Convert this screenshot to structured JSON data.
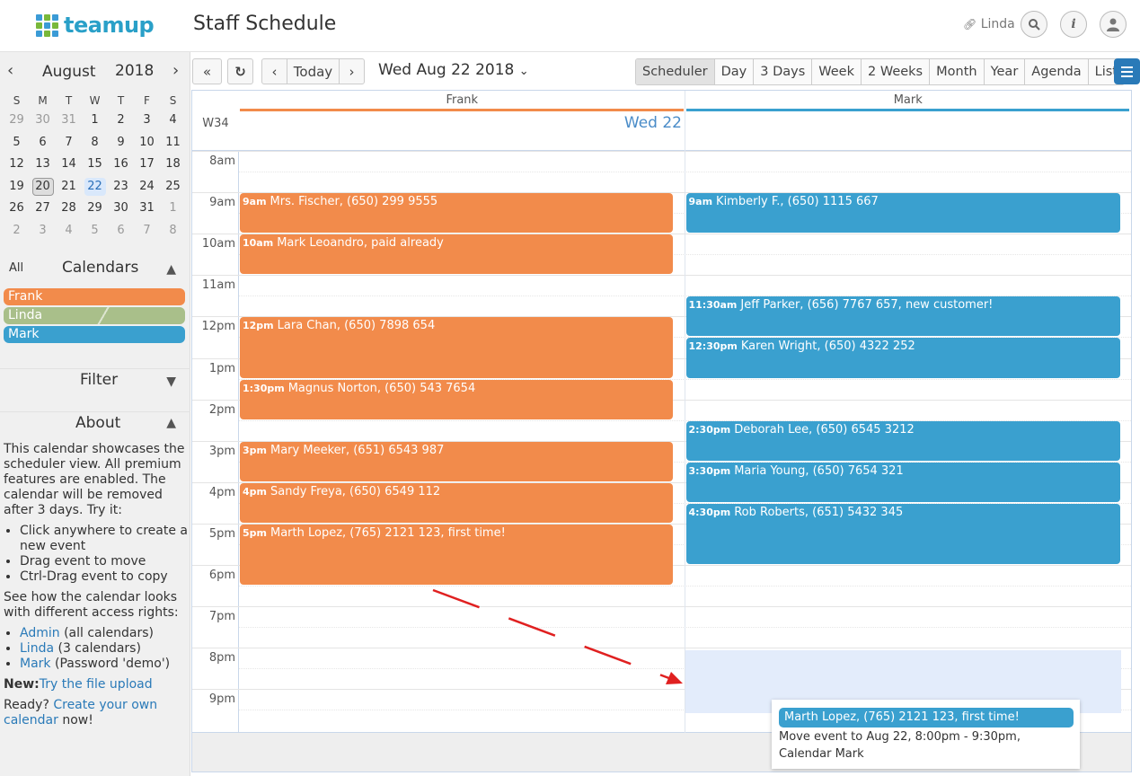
{
  "header": {
    "brand": "teamup",
    "title": "Staff Schedule",
    "user": "Linda",
    "logo_colors": [
      "#3b9bd6",
      "#79b83a",
      "#3b9bd6",
      "#79b83a",
      "#3b9bd6",
      "#79b83a",
      "#3b9bd6",
      "#79b83a",
      "#3b9bd6"
    ]
  },
  "mini_calendar": {
    "month": "August",
    "year": "2018",
    "weekdays": [
      "S",
      "M",
      "T",
      "W",
      "T",
      "F",
      "S"
    ],
    "weeks": [
      [
        "29",
        "30",
        "31",
        "1",
        "2",
        "3",
        "4"
      ],
      [
        "5",
        "6",
        "7",
        "8",
        "9",
        "10",
        "11"
      ],
      [
        "12",
        "13",
        "14",
        "15",
        "16",
        "17",
        "18"
      ],
      [
        "19",
        "20",
        "21",
        "22",
        "23",
        "24",
        "25"
      ],
      [
        "26",
        "27",
        "28",
        "29",
        "30",
        "31",
        "1"
      ],
      [
        "2",
        "3",
        "4",
        "5",
        "6",
        "7",
        "8"
      ]
    ],
    "today": "20",
    "selected": "22"
  },
  "sidebar": {
    "all_label": "All",
    "calendars_label": "Calendars",
    "calendars": [
      {
        "name": "Frank",
        "color": "#f28b4b"
      },
      {
        "name": "Linda",
        "color": "#a9bf8a"
      },
      {
        "name": "Mark",
        "color": "#3aa0cf"
      }
    ],
    "filter_label": "Filter",
    "about_label": "About",
    "about_intro": "This calendar showcases the scheduler view. All premium features are enabled. The calendar will be removed after 3 days. Try it:",
    "tips": [
      "Click anywhere to create a new event",
      "Drag event to move",
      "Ctrl-Drag event to copy"
    ],
    "access_intro": "See how the calendar looks with different access rights:",
    "access_links": [
      {
        "link": "Admin",
        "note": " (all calendars)"
      },
      {
        "link": "Linda",
        "note": " (3 calendars)"
      },
      {
        "link": "Mark",
        "note": " (Password 'demo')"
      }
    ],
    "new_label": "New:",
    "new_link": "Try the file upload",
    "ready_text": "Ready? ",
    "ready_link": "Create your own calendar",
    "ready_tail": " now!"
  },
  "toolbar": {
    "today_label": "Today",
    "date": "Wed Aug 22 2018",
    "views": [
      "Scheduler",
      "Day",
      "3 Days",
      "Week",
      "2 Weeks",
      "Month",
      "Year",
      "Agenda",
      "List"
    ],
    "active_view": "Scheduler"
  },
  "scheduler": {
    "week": "W34",
    "day_label": "Wed 22",
    "columns": [
      {
        "name": "Frank",
        "color": "#f28b4b"
      },
      {
        "name": "Mark",
        "color": "#3aa0cf"
      }
    ],
    "hours": [
      "8am",
      "9am",
      "10am",
      "11am",
      "12pm",
      "1pm",
      "2pm",
      "3pm",
      "4pm",
      "5pm",
      "6pm",
      "7pm",
      "8pm",
      "9pm"
    ],
    "events": [
      {
        "col": 0,
        "start": 9.0,
        "end": 10.0,
        "time": "9am",
        "text": "Mrs. Fischer, (650) 299 9555"
      },
      {
        "col": 0,
        "start": 10.0,
        "end": 11.0,
        "time": "10am",
        "text": "Mark Leoandro, paid already"
      },
      {
        "col": 0,
        "start": 12.0,
        "end": 13.5,
        "time": "12pm",
        "text": "Lara Chan, (650) 7898 654"
      },
      {
        "col": 0,
        "start": 13.5,
        "end": 14.5,
        "time": "1:30pm",
        "text": "Magnus Norton, (650) 543 7654"
      },
      {
        "col": 0,
        "start": 15.0,
        "end": 16.0,
        "time": "3pm",
        "text": "Mary Meeker, (651) 6543 987"
      },
      {
        "col": 0,
        "start": 16.0,
        "end": 17.0,
        "time": "4pm",
        "text": "Sandy Freya, (650) 6549 112"
      },
      {
        "col": 0,
        "start": 17.0,
        "end": 18.5,
        "time": "5pm",
        "text": "Marth Lopez, (765) 2121 123, first time!"
      },
      {
        "col": 1,
        "start": 9.0,
        "end": 10.0,
        "time": "9am",
        "text": "Kimberly F., (650) 1115 667"
      },
      {
        "col": 1,
        "start": 11.5,
        "end": 12.5,
        "time": "11:30am",
        "text": "Jeff Parker, (656) 7767 657, new customer!"
      },
      {
        "col": 1,
        "start": 12.5,
        "end": 13.5,
        "time": "12:30pm",
        "text": "Karen Wright, (650) 4322 252"
      },
      {
        "col": 1,
        "start": 14.5,
        "end": 15.5,
        "time": "2:30pm",
        "text": "Deborah Lee, (650) 6545 3212"
      },
      {
        "col": 1,
        "start": 15.5,
        "end": 16.5,
        "time": "3:30pm",
        "text": "Maria Young, (650) 7654 321"
      },
      {
        "col": 1,
        "start": 16.5,
        "end": 18.0,
        "time": "4:30pm",
        "text": "Rob Roberts, (651) 5432 345"
      }
    ]
  },
  "drag_tooltip": {
    "event_title": "Marth Lopez, (765) 2121 123, first time!",
    "message": "Move event to Aug 22, 8:00pm - 9:30pm, Calendar Mark"
  }
}
